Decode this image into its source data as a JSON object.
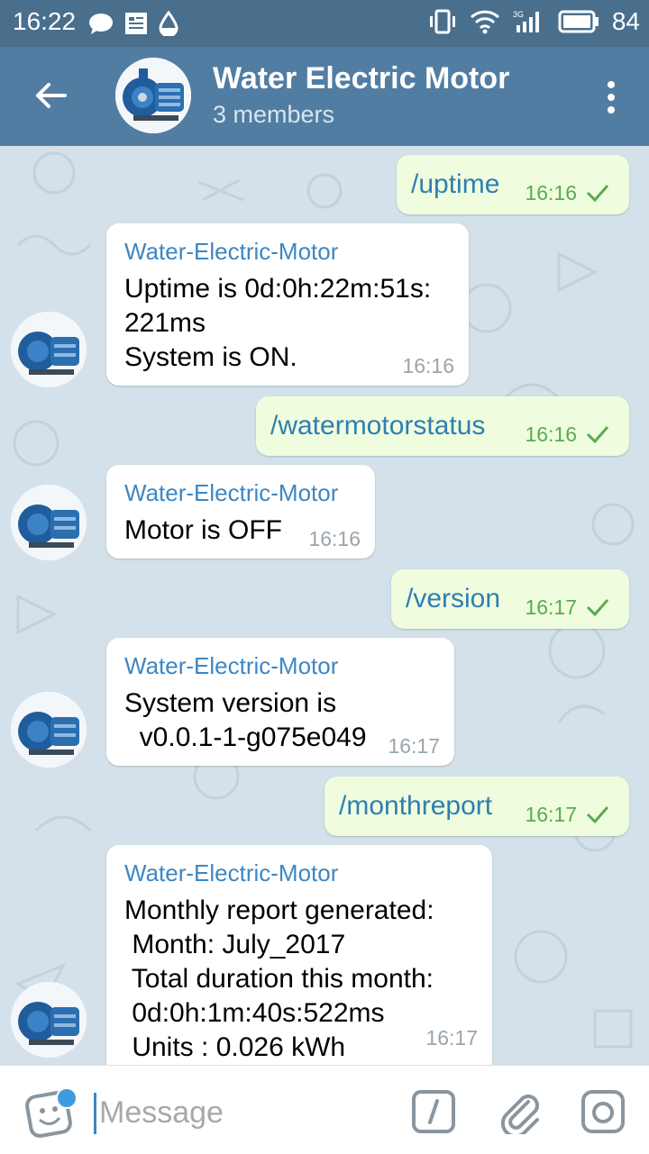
{
  "status_bar": {
    "time": "16:22",
    "battery": "84",
    "icons": [
      "chat-bubble-icon",
      "news-icon",
      "drop-icon",
      "vibrate-icon",
      "wifi-icon",
      "signal-3g-icon",
      "battery-icon"
    ]
  },
  "header": {
    "title": "Water Electric Motor",
    "subtitle": "3 members"
  },
  "messages": [
    {
      "type": "out",
      "text": "/uptime",
      "time": "16:16"
    },
    {
      "type": "in",
      "sender": "Water-Electric-Motor",
      "text": "Uptime is 0d:0h:22m:51s:\n221ms\nSystem is ON.",
      "time": "16:16"
    },
    {
      "type": "out",
      "text": "/watermotorstatus",
      "time": "16:16"
    },
    {
      "type": "in",
      "sender": "Water-Electric-Motor",
      "text": "Motor is OFF",
      "time": "16:16"
    },
    {
      "type": "out",
      "text": "/version",
      "time": "16:17"
    },
    {
      "type": "in",
      "sender": "Water-Electric-Motor",
      "text": "System version is\n  v0.0.1-1-g075e049",
      "time": "16:17"
    },
    {
      "type": "out",
      "text": "/monthreport",
      "time": "16:17"
    },
    {
      "type": "in",
      "sender": "Water-Electric-Motor",
      "text": "Monthly report generated:\n Month: July_2017\n Total duration this month:\n 0d:0h:1m:40s:522ms\n Units : 0.026 kWh",
      "time": "16:17"
    }
  ],
  "input": {
    "placeholder": "Message"
  },
  "colors": {
    "header": "#527da3",
    "status": "#4a6f8d",
    "outgoing": "#effdde",
    "sender": "#3d87c4"
  }
}
